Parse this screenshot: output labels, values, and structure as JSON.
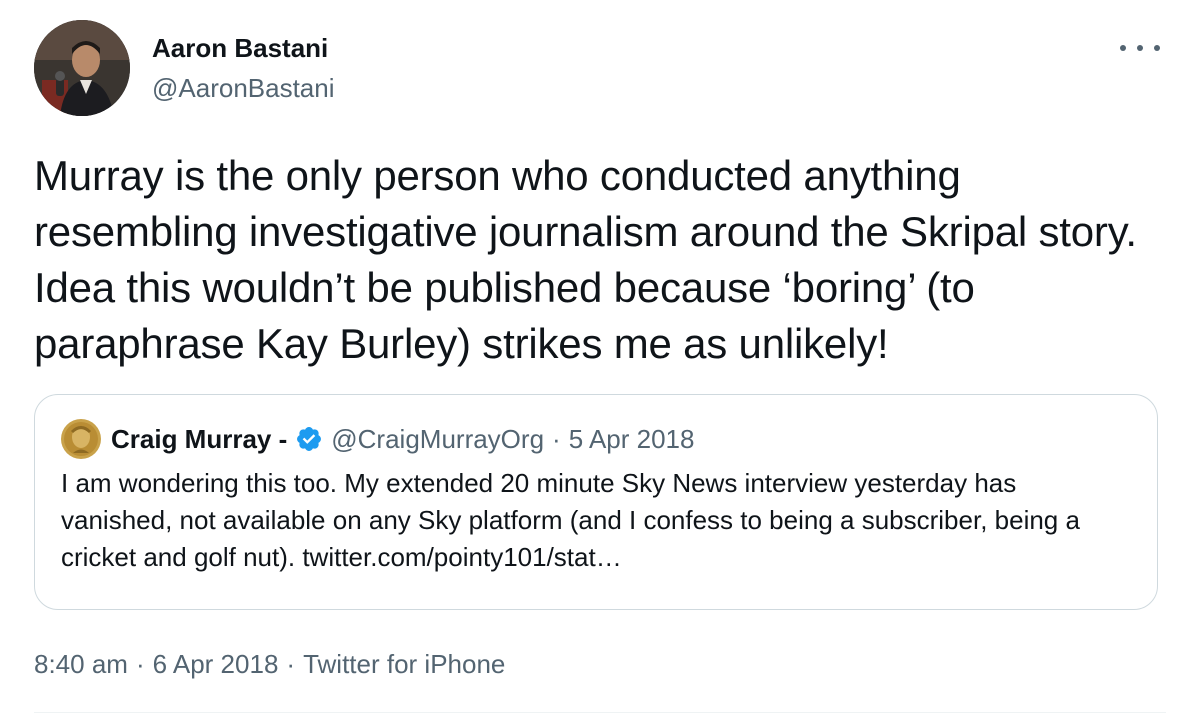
{
  "author": {
    "display_name": "Aaron Bastani",
    "handle": "@AaronBastani"
  },
  "more_menu_icon": "more-horizontal-icon",
  "tweet_text": "Murray is the only person who conducted anything resembling investigative journalism around the Skripal story. Idea this wouldn’t be published because ‘boring’ (to paraphrase Kay Burley) strikes me as unlikely!",
  "quoted_tweet": {
    "display_name": "Craig Murray -",
    "verified_icon": "verified-badge-icon",
    "handle": "@CraigMurrayOrg",
    "separator": "·",
    "date": "5 Apr 2018",
    "text": "I am wondering this too. My extended 20 minute Sky News interview yesterday has vanished, not available on any Sky platform (and I confess to being a subscriber, being a cricket and golf nut). twitter.com/pointy101/stat…"
  },
  "meta": {
    "time": "8:40 am",
    "separator": "·",
    "date": "6 Apr 2018",
    "source": "Twitter for iPhone"
  },
  "colors": {
    "text_primary": "#0f1419",
    "text_secondary": "#536471",
    "border": "#cfd9de",
    "verified_blue": "#1d9bf0"
  }
}
